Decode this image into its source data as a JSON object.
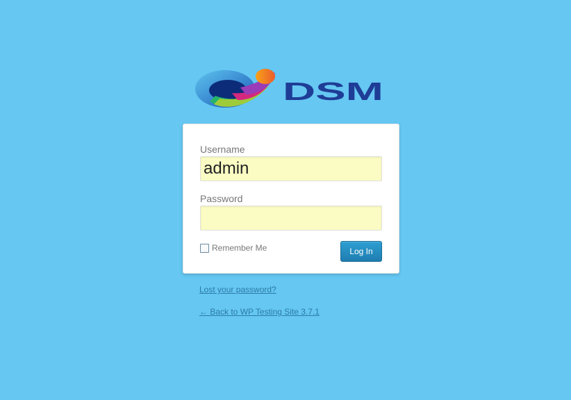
{
  "logo": {
    "text": "DSM",
    "brand_color": "#1e3d96"
  },
  "form": {
    "username_label": "Username",
    "username_value": "admin",
    "password_label": "Password",
    "password_value": "",
    "remember_label": "Remember Me",
    "remember_checked": false,
    "login_label": "Log In"
  },
  "links": {
    "lost_password": "Lost your password?",
    "back_to_site": "← Back to WP Testing Site 3.7.1"
  },
  "colors": {
    "background": "#65c7f2",
    "input_fill": "#fbfcc3",
    "button": "#2482b8",
    "link": "#2b7ba5"
  }
}
